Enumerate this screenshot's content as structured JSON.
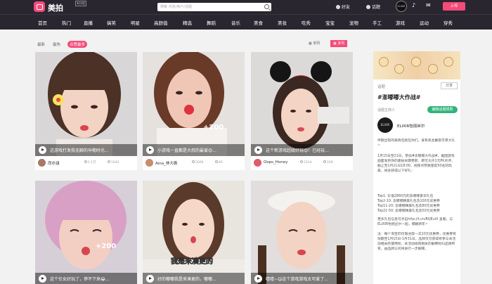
{
  "header": {
    "brand": "美拍",
    "beta": "有技能",
    "search_placeholder": "搜索 内容/用户/话题",
    "friends": "好友",
    "topics": "话题",
    "user_avatar_text": "ELIXIR",
    "upload": "上传"
  },
  "nav": [
    "首页",
    "热门",
    "直播",
    "搞笑",
    "明星",
    "高颜值",
    "精选",
    "舞蹈",
    "音乐",
    "美食",
    "美妆",
    "吃秀",
    "宝宝",
    "宠物",
    "手工",
    "游戏",
    "运动",
    "穿秀"
  ],
  "filters": [
    "最新",
    "最热",
    "点赞最多"
  ],
  "view_toggle": [
    "单列",
    "多列"
  ],
  "cards": [
    {
      "caption": "这游戏打发我无聊的孕期时光...",
      "author": "而亦涵",
      "likes": "1.1万",
      "comments": "1042"
    },
    {
      "caption": "小游戏一直都是大叔的最爱😍...",
      "author": "Aina_林大枫",
      "likes": "5006",
      "comments": "60"
    },
    {
      "caption": "这个新游戏超级好玩😍！已经玩...",
      "author": "Oops_Honey",
      "likes": "2314",
      "comments": "169"
    },
    {
      "caption": "这个仕女好玩了，停不下来😂...",
      "author": "",
      "likes": "",
      "comments": ""
    },
    {
      "caption": "好的嘟嘟我是来凑更的，嘟嘟...",
      "author": "",
      "likes": "",
      "comments": "",
      "overlay": "我是来凑更的"
    },
    {
      "caption": "嘻嘻~😋这个游戏游戏太可爱了...",
      "author": "",
      "likes": "",
      "comments": ""
    }
  ],
  "score_overlay": "+200",
  "sidebar": {
    "section": "话题",
    "share": "分享",
    "topic": "#澎嘟嘟大作战#",
    "host_label": "话题主持人",
    "join": "编辑话题规则",
    "host_avatar_text": "ELIXIR",
    "host_name": "ELIXIR怡丽丝尔",
    "paragraphs": [
      "伴随出现的表情包就在你们，爱有机会赢取丰厚大礼~",
      "1月15日至21日，参加#澎嘟嘟大作战#，截图游戏画面发到你的美拍本期更新，即可允许1元PK点评，截止至1月21日18:00，视频点赞数量前50名的玩家，将会获得以下好礼：",
      "Top1: 价值2860元的澎嘟嘟豪华礼包",
      "Top2-10: 澎嘟嘟精美礼包及100元优惠券",
      "Top11-20: 澎嘟嘟精美礼包及80元优惠券",
      "Top21-50: 澎嘟嘟精美礼包及50元优惠券",
      "更多礼包信息可点击http://t.cn/RQEuiX 查看，与ELIXIR怡丽丝尔一起，嘟翻新年~",
      "注：每个淘宝ID仅限兑取一次20元优惠券，优惠券有效期至1月15日-1月31日，品牌仅可获得有参与本活动相关的使用权，本活动规则相关的解释权归品牌所有，由品牌公司将进行一步解释。"
    ]
  }
}
